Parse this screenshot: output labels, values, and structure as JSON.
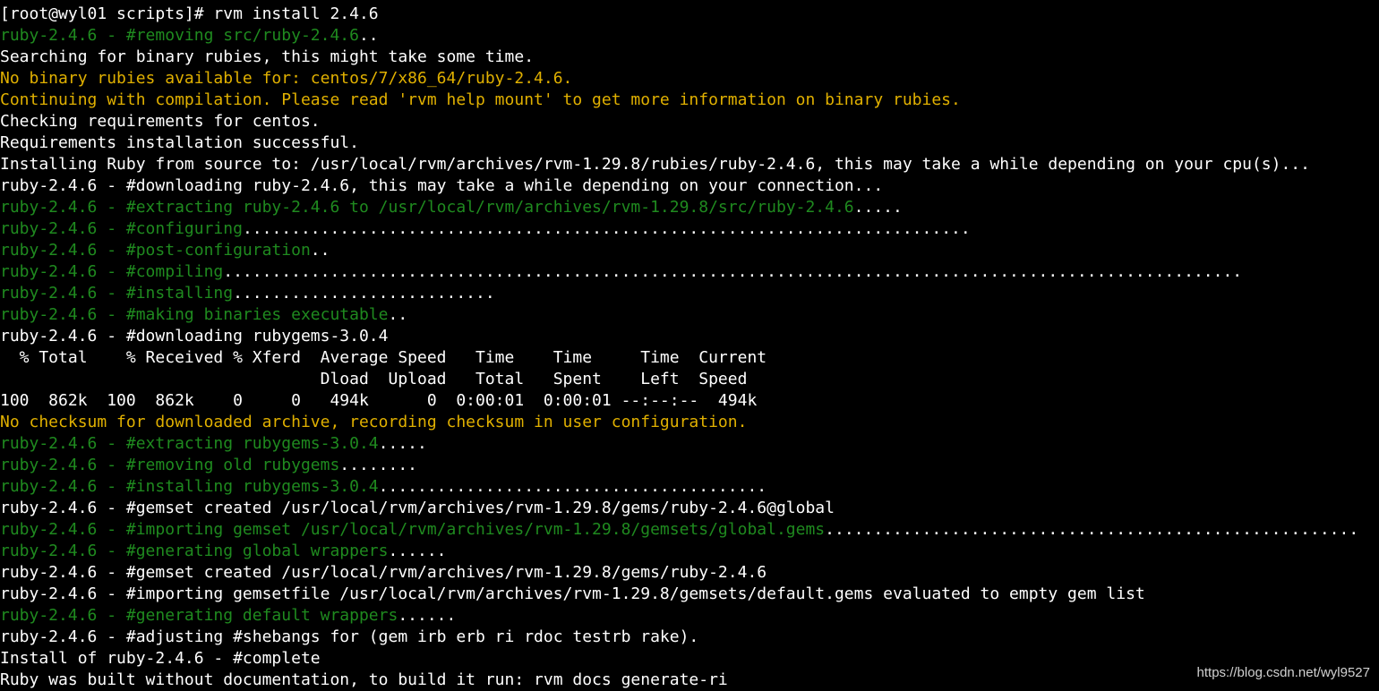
{
  "terminal": {
    "lines": [
      [
        {
          "text": "[root@wyl01 scripts]# rvm install 2.4.6",
          "color": "white"
        }
      ],
      [
        {
          "text": "ruby-2.4.6 - #removing src/ruby-2.4.6",
          "color": "green"
        },
        {
          "text": "..",
          "color": "white"
        }
      ],
      [
        {
          "text": "Searching for binary rubies, this might take some time.",
          "color": "white"
        }
      ],
      [
        {
          "text": "No binary rubies available for: centos/7/x86_64/ruby-2.4.6.",
          "color": "yellow"
        }
      ],
      [
        {
          "text": "Continuing with compilation. Please read 'rvm help mount' to get more information on binary rubies.",
          "color": "yellow"
        }
      ],
      [
        {
          "text": "Checking requirements for centos.",
          "color": "white"
        }
      ],
      [
        {
          "text": "Requirements installation successful.",
          "color": "white"
        }
      ],
      [
        {
          "text": "Installing Ruby from source to: /usr/local/rvm/archives/rvm-1.29.8/rubies/ruby-2.4.6, this may take a while depending on your cpu(s)...",
          "color": "white"
        }
      ],
      [
        {
          "text": "ruby-2.4.6 - #downloading ruby-2.4.6, this may take a while depending on your connection...",
          "color": "white"
        }
      ],
      [
        {
          "text": "ruby-2.4.6 - #extracting ruby-2.4.6 to /usr/local/rvm/archives/rvm-1.29.8/src/ruby-2.4.6",
          "color": "green"
        },
        {
          "text": ".....",
          "color": "white"
        }
      ],
      [
        {
          "text": "ruby-2.4.6 - #configuring",
          "color": "green"
        },
        {
          "text": "...........................................................................",
          "color": "white"
        }
      ],
      [
        {
          "text": "ruby-2.4.6 - #post-configuration",
          "color": "green"
        },
        {
          "text": "..",
          "color": "white"
        }
      ],
      [
        {
          "text": "ruby-2.4.6 - #compiling",
          "color": "green"
        },
        {
          "text": ".........................................................................................................",
          "color": "white"
        }
      ],
      [
        {
          "text": "ruby-2.4.6 - #installing",
          "color": "green"
        },
        {
          "text": "...........................",
          "color": "white"
        }
      ],
      [
        {
          "text": "ruby-2.4.6 - #making binaries executable",
          "color": "green"
        },
        {
          "text": "..",
          "color": "white"
        }
      ],
      [
        {
          "text": "ruby-2.4.6 - #downloading rubygems-3.0.4",
          "color": "white"
        }
      ],
      [
        {
          "text": "  % Total    % Received % Xferd  Average Speed   Time    Time     Time  Current",
          "color": "white"
        }
      ],
      [
        {
          "text": "                                 Dload  Upload   Total   Spent    Left  Speed",
          "color": "white"
        }
      ],
      [
        {
          "text": "100  862k  100  862k    0     0   494k      0  0:00:01  0:00:01 --:--:--  494k",
          "color": "white"
        }
      ],
      [
        {
          "text": "No checksum for downloaded archive, recording checksum in user configuration.",
          "color": "yellow"
        }
      ],
      [
        {
          "text": "ruby-2.4.6 - #extracting rubygems-3.0.4",
          "color": "green"
        },
        {
          "text": ".....",
          "color": "white"
        }
      ],
      [
        {
          "text": "ruby-2.4.6 - #removing old rubygems",
          "color": "green"
        },
        {
          "text": "........",
          "color": "white"
        }
      ],
      [
        {
          "text": "ruby-2.4.6 - #installing rubygems-3.0.4",
          "color": "green"
        },
        {
          "text": "........................................",
          "color": "white"
        }
      ],
      [
        {
          "text": "ruby-2.4.6 - #gemset created /usr/local/rvm/archives/rvm-1.29.8/gems/ruby-2.4.6@global",
          "color": "white"
        }
      ],
      [
        {
          "text": "ruby-2.4.6 - #importing gemset /usr/local/rvm/archives/rvm-1.29.8/gemsets/global.gems",
          "color": "green"
        },
        {
          "text": ".......................................................",
          "color": "white"
        }
      ],
      [
        {
          "text": "ruby-2.4.6 - #generating global wrappers",
          "color": "green"
        },
        {
          "text": "......",
          "color": "white"
        }
      ],
      [
        {
          "text": "ruby-2.4.6 - #gemset created /usr/local/rvm/archives/rvm-1.29.8/gems/ruby-2.4.6",
          "color": "white"
        }
      ],
      [
        {
          "text": "ruby-2.4.6 - #importing gemsetfile /usr/local/rvm/archives/rvm-1.29.8/gemsets/default.gems evaluated to empty gem list",
          "color": "white"
        }
      ],
      [
        {
          "text": "ruby-2.4.6 - #generating default wrappers",
          "color": "green"
        },
        {
          "text": "......",
          "color": "white"
        }
      ],
      [
        {
          "text": "ruby-2.4.6 - #adjusting #shebangs for (gem irb erb ri rdoc testrb rake).",
          "color": "white"
        }
      ],
      [
        {
          "text": "Install of ruby-2.4.6 - #complete",
          "color": "white"
        }
      ],
      [
        {
          "text": "Ruby was built without documentation, to build it run: rvm docs generate-ri",
          "color": "white"
        }
      ]
    ]
  },
  "watermark": "https://blog.csdn.net/wyl9527",
  "colors": {
    "background": "#000000",
    "white": "#ffffff",
    "green": "#1f8a1f",
    "yellow": "#e0b000"
  }
}
